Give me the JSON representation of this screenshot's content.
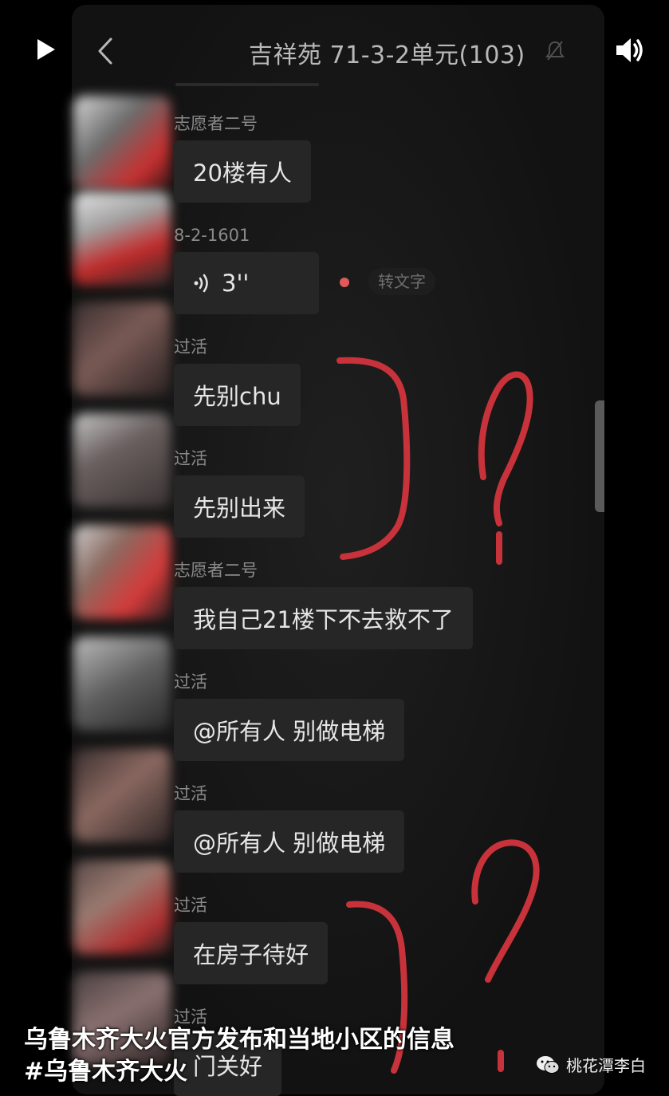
{
  "chat": {
    "title": "吉祥苑 71-3-2单元(103)"
  },
  "messages": [
    {
      "sender": "志愿者二号",
      "text": "20楼有人"
    },
    {
      "sender": "8-2-1601",
      "voice_duration": "3''",
      "to_text_label": "转文字"
    },
    {
      "sender": "过活",
      "text": "先别chu"
    },
    {
      "sender": "过活",
      "text": "先别出来"
    },
    {
      "sender": "志愿者二号",
      "text": "我自己21楼下不去救不了"
    },
    {
      "sender": "过活",
      "text": "@所有人 别做电梯"
    },
    {
      "sender": "过活",
      "text": "@所有人 别做电梯"
    },
    {
      "sender": "过活",
      "text": "在房子待好"
    },
    {
      "sender": "过活",
      "text": "门关好"
    }
  ],
  "caption": {
    "line1": "乌鲁木齐大火官方发布和当地小区的信息",
    "line2": "#乌鲁木齐大火"
  },
  "watermark": {
    "text": "桃花潭李白"
  },
  "colors": {
    "annotation_red": "#c8323a",
    "bubble_bg": "#262626",
    "phone_bg": "#121212"
  }
}
